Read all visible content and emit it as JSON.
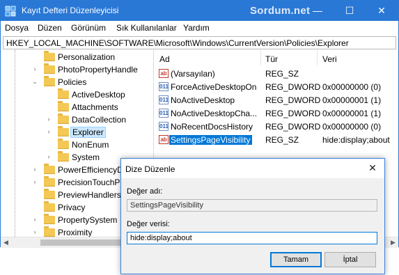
{
  "window": {
    "title": "Kayıt Defteri Düzenleyicisi",
    "watermark": "Sordum.net",
    "controls": {
      "minimize": "—",
      "maximize": "☐",
      "close": "✕"
    }
  },
  "menu": [
    "Dosya",
    "Düzen",
    "Görünüm",
    "Sık Kullanılanlar",
    "Yardım"
  ],
  "address": "HKEY_LOCAL_MACHINE\\SOFTWARE\\Microsoft\\Windows\\CurrentVersion\\Policies\\Explorer",
  "tree": [
    {
      "label": "Personalization",
      "arrow": ""
    },
    {
      "label": "PhotoPropertyHandle",
      "arrow": "›"
    },
    {
      "label": "Policies",
      "arrow": "⌄"
    },
    {
      "label": "ActiveDesktop",
      "arrow": ""
    },
    {
      "label": "Attachments",
      "arrow": ""
    },
    {
      "label": "DataCollection",
      "arrow": "›"
    },
    {
      "label": "Explorer",
      "arrow": "›",
      "selected": true
    },
    {
      "label": "NonEnum",
      "arrow": ""
    },
    {
      "label": "System",
      "arrow": "›"
    },
    {
      "label": "PowerEfficiencyD",
      "arrow": "›"
    },
    {
      "label": "PrecisionTouchPa",
      "arrow": "›"
    },
    {
      "label": "PreviewHandlers",
      "arrow": ""
    },
    {
      "label": "Privacy",
      "arrow": ""
    },
    {
      "label": "PropertySystem",
      "arrow": "›"
    },
    {
      "label": "Proximity",
      "arrow": "›"
    }
  ],
  "list": {
    "headers": {
      "name": "Ad",
      "type": "Tür",
      "data": "Veri"
    },
    "rows": [
      {
        "icon": "ab",
        "name": "(Varsayılan)",
        "type": "REG_SZ",
        "data": ""
      },
      {
        "icon": "bin",
        "name": "ForceActiveDesktopOn",
        "type": "REG_DWORD",
        "data": "0x00000000 (0)"
      },
      {
        "icon": "bin",
        "name": "NoActiveDesktop",
        "type": "REG_DWORD",
        "data": "0x00000001 (1)"
      },
      {
        "icon": "bin",
        "name": "NoActiveDesktopCha...",
        "type": "REG_DWORD",
        "data": "0x00000001 (1)"
      },
      {
        "icon": "bin",
        "name": "NoRecentDocsHistory",
        "type": "REG_DWORD",
        "data": "0x00000000 (0)"
      },
      {
        "icon": "ab",
        "name": "SettingsPageVisibility",
        "type": "REG_SZ",
        "data": "hide:display;about",
        "selected": true
      }
    ]
  },
  "dialog": {
    "title": "Dize Düzenle",
    "close": "✕",
    "name_label": "Değer adı:",
    "name_value": "SettingsPageVisibility",
    "data_label": "Değer verisi:",
    "data_value": "hide:display;about",
    "ok": "Tamam",
    "cancel": "İptal"
  },
  "colors": {
    "titlebar": "#2a78d6",
    "selection": "#0078d7",
    "tree_selection": "#cce8ff",
    "folder": "#f3c854"
  }
}
